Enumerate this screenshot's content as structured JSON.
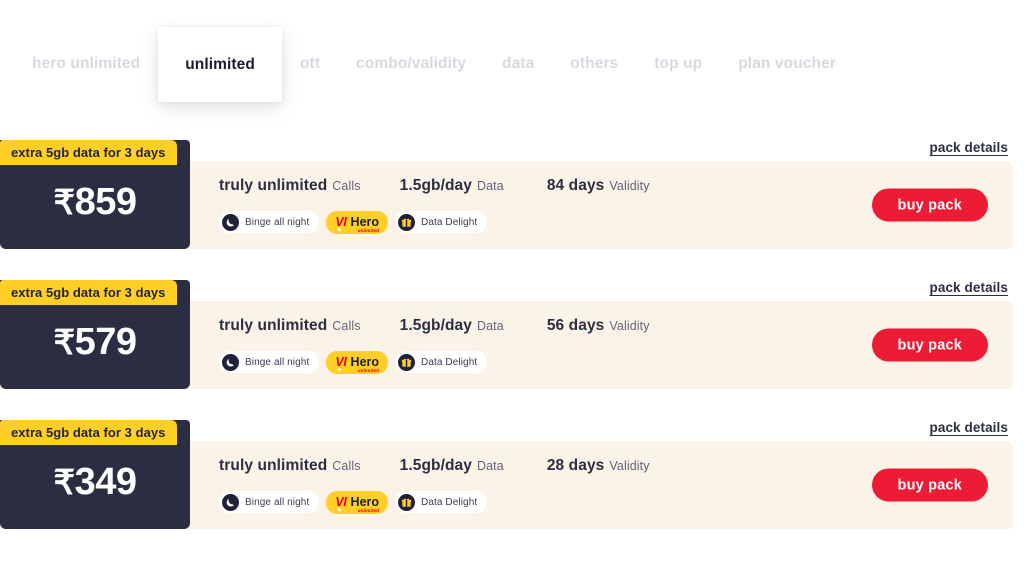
{
  "tabs": [
    {
      "label": "hero unlimited",
      "active": false
    },
    {
      "label": "unlimited",
      "active": true
    },
    {
      "label": "ott",
      "active": false
    },
    {
      "label": "combo/validity",
      "active": false
    },
    {
      "label": "data",
      "active": false
    },
    {
      "label": "others",
      "active": false
    },
    {
      "label": "top up",
      "active": false
    },
    {
      "label": "plan voucher",
      "active": false
    }
  ],
  "common": {
    "pack_details_label": "pack details",
    "buy_pack_label": "buy pack",
    "offer_badge": "extra 5gb data for 3 days",
    "rupee_symbol": "₹",
    "calls_label": "Calls",
    "data_label": "Data",
    "validity_label": "Validity",
    "benefit_binge": "Binge all night",
    "benefit_data_delight": "Data Delight",
    "hero_brand": "VI",
    "hero_name": "Hero",
    "hero_sub": "unlimited"
  },
  "colors": {
    "accent_red": "#ed1b34",
    "badge_yellow": "#ffcf28",
    "dark_navy": "#2b2d42",
    "card_cream": "#fcf3e8",
    "tab_inactive": "#d8d8e0"
  },
  "plans": [
    {
      "price": "859",
      "calls_value": "truly unlimited",
      "data_value": "1.5gb/day",
      "validity_value": "84 days"
    },
    {
      "price": "579",
      "calls_value": "truly unlimited",
      "data_value": "1.5gb/day",
      "validity_value": "56 days"
    },
    {
      "price": "349",
      "calls_value": "truly unlimited",
      "data_value": "1.5gb/day",
      "validity_value": "28 days"
    }
  ]
}
